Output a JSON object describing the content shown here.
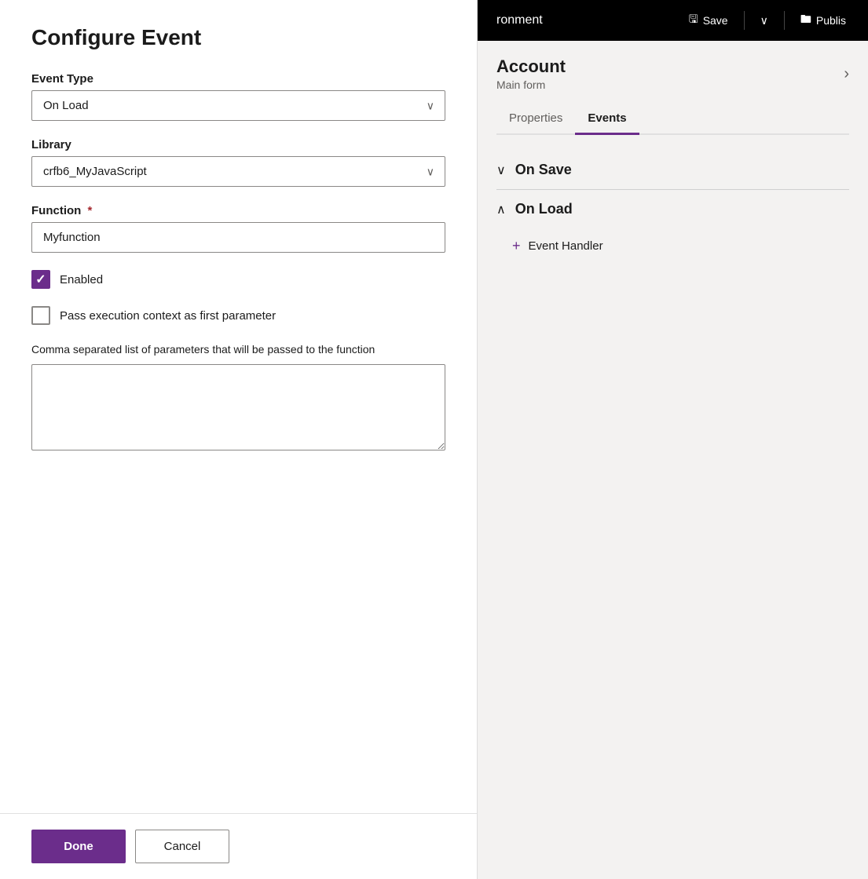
{
  "dialog": {
    "title": "Configure Event",
    "event_type_label": "Event Type",
    "event_type_value": "On Load",
    "library_label": "Library",
    "library_value": "crfb6_MyJavaScript",
    "function_label": "Function",
    "function_required": "*",
    "function_value": "Myfunction",
    "enabled_label": "Enabled",
    "pass_context_label": "Pass execution context as first parameter",
    "params_label": "Comma separated list of parameters that will be passed to the function",
    "params_value": "",
    "done_label": "Done",
    "cancel_label": "Cancel"
  },
  "topbar": {
    "title": "ronment",
    "save_label": "Save",
    "publish_label": "Publis"
  },
  "entity": {
    "name": "Account",
    "subname": "Main form"
  },
  "tabs": [
    {
      "label": "Properties",
      "active": false
    },
    {
      "label": "Events",
      "active": true
    }
  ],
  "events": {
    "on_save_label": "On Save",
    "on_load_label": "On Load",
    "add_handler_label": "Event Handler"
  },
  "icons": {
    "save": "💾",
    "publish": "📤",
    "chevron_down": "⌄",
    "chevron_right": "›",
    "chevron_expand": "∨",
    "chevron_collapse": "∧",
    "plus": "+"
  }
}
